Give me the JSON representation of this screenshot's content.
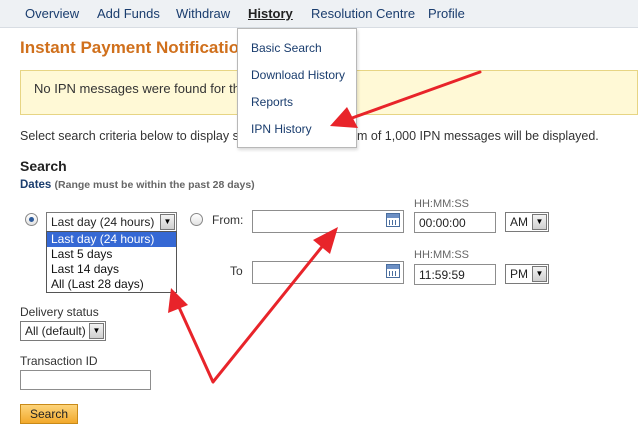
{
  "nav": {
    "items": [
      "Overview",
      "Add Funds",
      "Withdraw",
      "History",
      "Resolution Centre",
      "Profile"
    ],
    "active": "History"
  },
  "history_menu": {
    "items": [
      "Basic Search",
      "Download History",
      "Reports",
      "IPN History"
    ]
  },
  "page": {
    "title": "Instant Payment Notification",
    "notice": "No IPN messages were found for the p",
    "instructions_left": "Select search criteria below to display se",
    "instructions_right": "m of 1,000 IPN messages will be displayed."
  },
  "search": {
    "heading": "Search",
    "dates_label": "Dates",
    "dates_hint": "(Range must be within the past 28 days)",
    "range_select": {
      "selected": "Last day (24 hours)",
      "options": [
        "Last day (24 hours)",
        "Last 5 days",
        "Last 14 days",
        "All (Last 28 days)"
      ]
    },
    "from_label": "From:",
    "to_label": "To",
    "time_format_label": "HH:MM:SS",
    "from_date": "",
    "from_time": "00:00:00",
    "from_ampm": "AM",
    "to_date": "",
    "to_time": "11:59:59",
    "to_ampm": "PM",
    "delivery_status_label": "Delivery status",
    "delivery_status_value": "All (default)",
    "transaction_id_label": "Transaction ID",
    "transaction_id_value": "",
    "submit_label": "Search"
  },
  "colors": {
    "title": "#d0701c",
    "link": "#1a3d6e",
    "notice_bg": "#fff9d6",
    "annotation_arrow": "#e8242a",
    "selected_option": "#3568d4"
  }
}
